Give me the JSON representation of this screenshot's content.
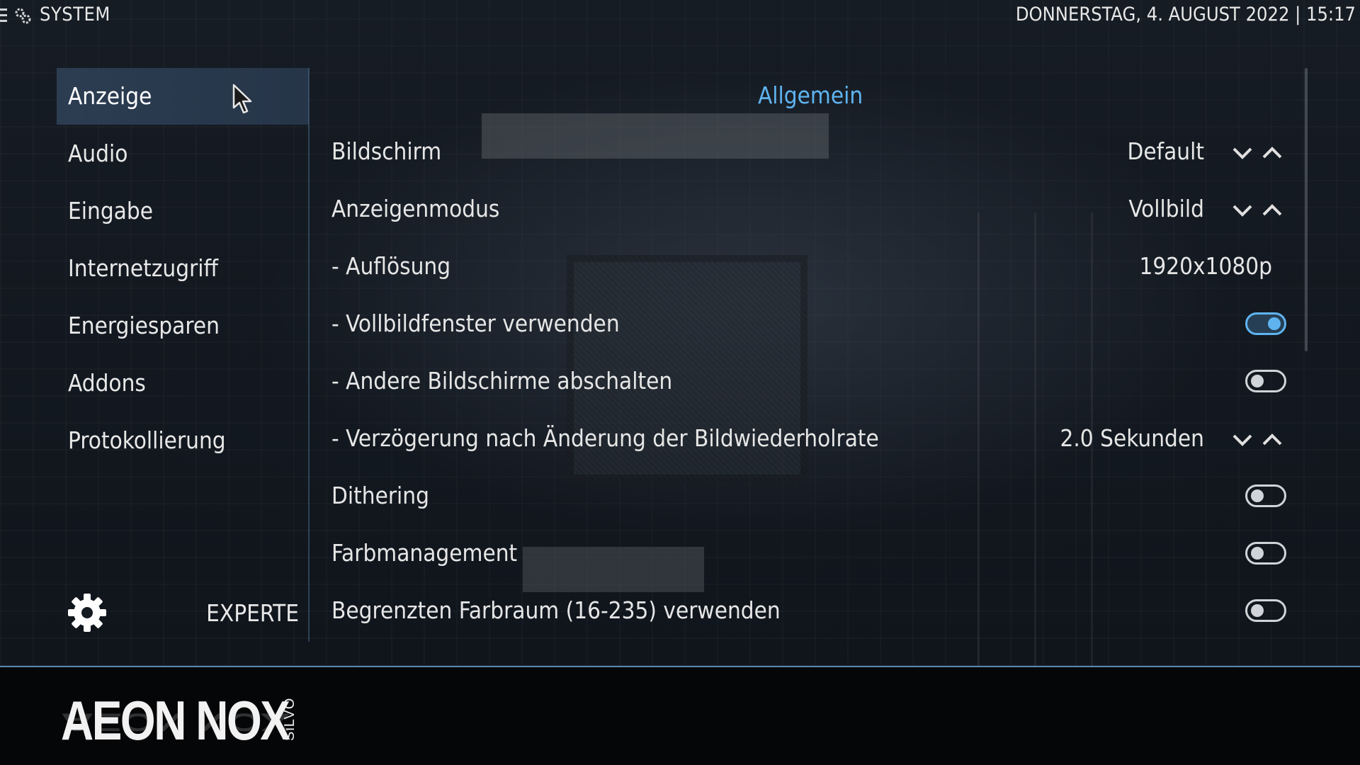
{
  "header": {
    "title": "SYSTEM",
    "datetime": "DONNERSTAG, 4. AUGUST 2022 | 15:17"
  },
  "sidebar": {
    "items": [
      {
        "label": "Anzeige",
        "active": true
      },
      {
        "label": "Audio"
      },
      {
        "label": "Eingabe"
      },
      {
        "label": "Internetzugriff"
      },
      {
        "label": "Energiesparen"
      },
      {
        "label": "Addons"
      },
      {
        "label": "Protokollierung"
      }
    ],
    "level_label": "EXPERTE"
  },
  "section": {
    "title": "Allgemein"
  },
  "settings": [
    {
      "label": "Bildschirm",
      "type": "spinner",
      "value": "Default"
    },
    {
      "label": "Anzeigenmodus",
      "type": "spinner",
      "value": "Vollbild"
    },
    {
      "label": "- Auflösung",
      "type": "value",
      "value": "1920x1080p"
    },
    {
      "label": "- Vollbildfenster verwenden",
      "type": "toggle",
      "on": true
    },
    {
      "label": "- Andere Bildschirme abschalten",
      "type": "toggle",
      "on": false
    },
    {
      "label": "- Verzögerung nach Änderung der Bildwiederholrate",
      "type": "spinner",
      "value": "2.0 Sekunden"
    },
    {
      "label": "Dithering",
      "type": "toggle",
      "on": false
    },
    {
      "label": "Farbmanagement",
      "type": "toggle",
      "on": false
    },
    {
      "label": "Begrenzten Farbraum (16-235) verwenden",
      "type": "toggle",
      "on": false
    }
  ],
  "footer": {
    "logo": "AEON NOX",
    "logo_sub": "SiLVO"
  },
  "colors": {
    "accent": "#5fb4f0",
    "active_item_bg": "#2c3d52",
    "footer_bg": "#050607"
  }
}
